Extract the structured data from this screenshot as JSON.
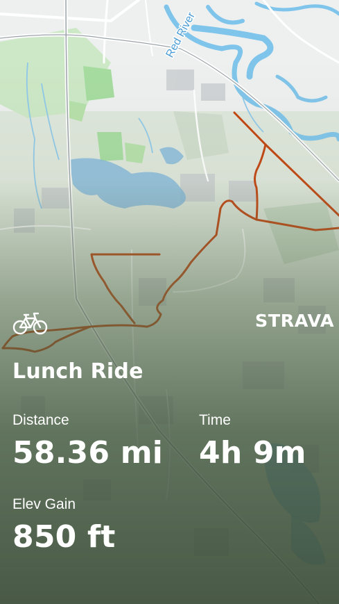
{
  "map": {
    "label": "Red River",
    "route_color": "#c2410c",
    "water_color": "#7fc4ea",
    "land_color": "#dfe7dc",
    "park_color": "#a8d8a0"
  },
  "activity": {
    "title": "Lunch Ride",
    "sport_icon": "bicycle-icon"
  },
  "brand": {
    "name": "STRAVA"
  },
  "stats": {
    "distance": {
      "label": "Distance",
      "value": "58.36 mi"
    },
    "time": {
      "label": "Time",
      "value": "4h 9m"
    },
    "elev_gain": {
      "label": "Elev Gain",
      "value": "850 ft"
    }
  }
}
